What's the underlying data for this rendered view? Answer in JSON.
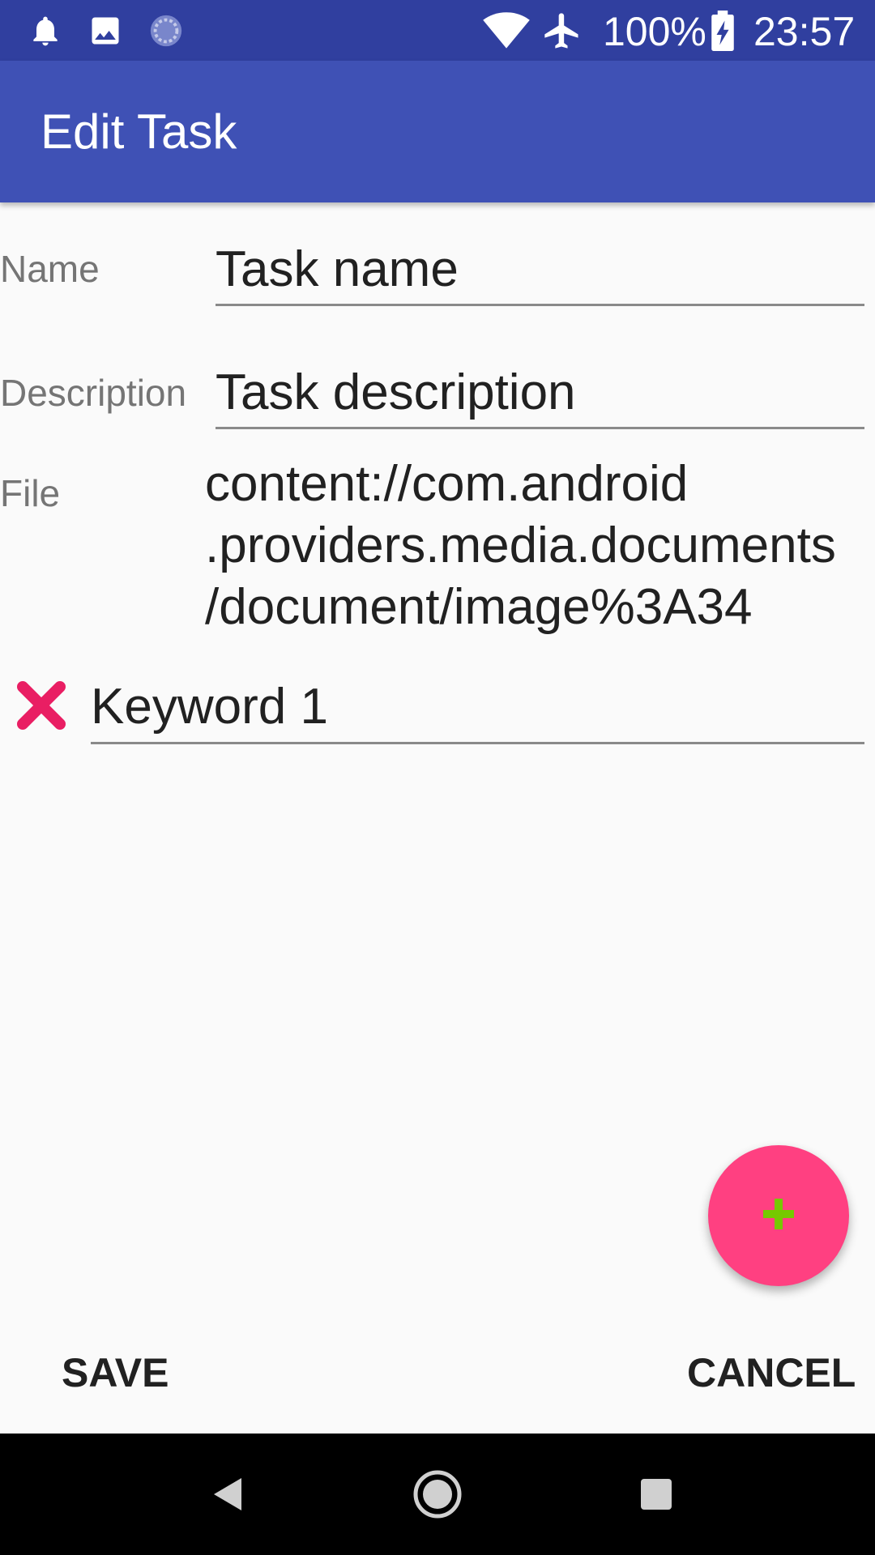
{
  "status_bar": {
    "battery": "100%",
    "time": "23:57",
    "icons": [
      "bell-icon",
      "image-icon",
      "sync-icon",
      "wifi-icon",
      "airplane-icon",
      "battery-charging-icon"
    ]
  },
  "app_bar": {
    "title": "Edit Task"
  },
  "form": {
    "name_label": "Name",
    "name_value": "Task name",
    "description_label": "Description",
    "description_value": "Task description",
    "file_label": "File",
    "file_lines": [
      "content://com.android",
      ".providers.media.documents",
      "/document/image%3A34"
    ],
    "keywords": [
      {
        "value": "Keyword 1"
      }
    ]
  },
  "actions": {
    "save_label": "SAVE",
    "cancel_label": "CANCEL"
  },
  "colors": {
    "primary": "#3f51b5",
    "primary_dark": "#303f9f",
    "accent": "#ff4081",
    "delete": "#e91e63",
    "fab_plus": "#76c900"
  }
}
